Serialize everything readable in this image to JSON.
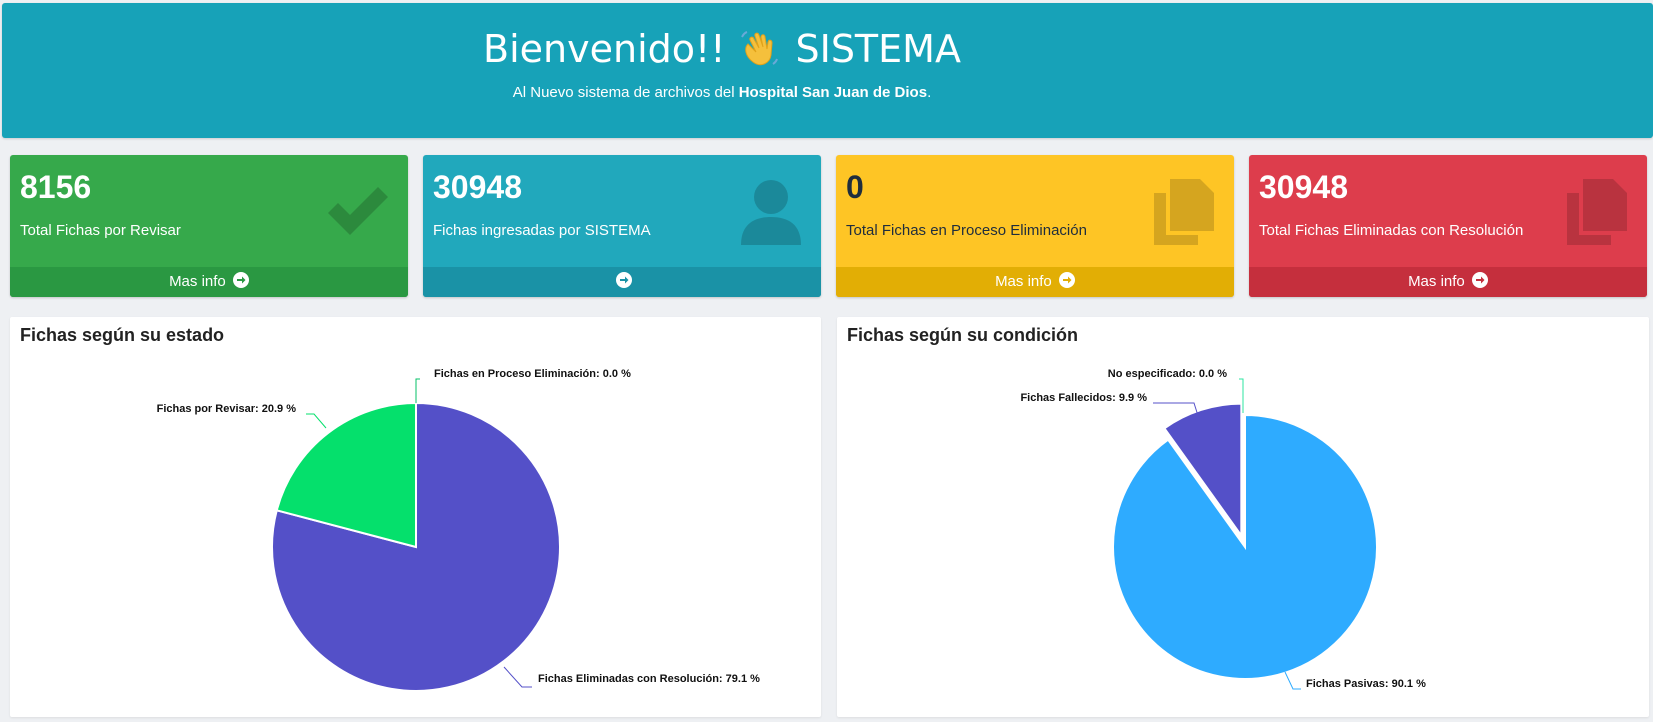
{
  "banner": {
    "title": "Bienvenido!!",
    "title_system": "SISTEMA",
    "subtitle_prefix": "Al Nuevo sistema de archivos del ",
    "subtitle_bold": "Hospital San Juan de Dios",
    "subtitle_suffix": "."
  },
  "info_boxes": [
    {
      "value": "8156",
      "label": "Total Fichas por Revisar",
      "footer": "Mas info",
      "icon": "check-icon",
      "color": "#36a94b"
    },
    {
      "value": "30948",
      "label": "Fichas ingresadas por SISTEMA",
      "footer": "",
      "icon": "user-icon",
      "color": "#21a8bc"
    },
    {
      "value": "0",
      "label": "Total Fichas en Proceso Eliminación",
      "footer": "Mas info",
      "icon": "copy-icon",
      "color": "#fec525"
    },
    {
      "value": "30948",
      "label": "Total Fichas Eliminadas con Resolución",
      "footer": "Mas info",
      "icon": "copy-icon",
      "color": "#dd3d4c"
    }
  ],
  "chart_data": [
    {
      "type": "pie",
      "title": "Fichas según su estado",
      "slices": [
        {
          "label": "Fichas en Proceso Eliminación: 0.0 %",
          "value": 0.0,
          "color": "#06c167"
        },
        {
          "label": "Fichas Eliminadas con Resolución: 79.1 %",
          "value": 79.1,
          "color": "#5450c8"
        },
        {
          "label": "Fichas por Revisar: 20.9 %",
          "value": 20.9,
          "color": "#05e06c"
        }
      ]
    },
    {
      "type": "pie",
      "title": "Fichas según su condición",
      "slices": [
        {
          "label": "No especificado: 0.0 %",
          "value": 0.0,
          "color": "#2ee6a0"
        },
        {
          "label": "Fichas Pasivas: 90.1 %",
          "value": 90.1,
          "color": "#2eabff"
        },
        {
          "label": "Fichas Fallecidos: 9.9 %",
          "value": 9.9,
          "color": "#5450c8"
        }
      ]
    }
  ]
}
